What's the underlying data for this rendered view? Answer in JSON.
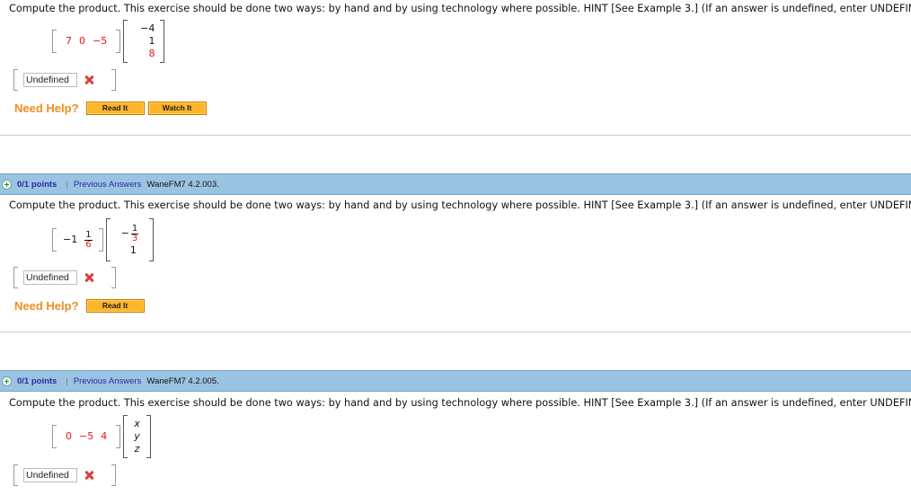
{
  "colors": {
    "accent_orange": "#f28c1e",
    "button_fill": "#fdb52b",
    "header_bar": "#9ac3e2",
    "link_blue": "#2a2aa0",
    "error_red": "#e03a3a",
    "highlight_red": "#e8141a"
  },
  "questions": [
    {
      "prompt": "Compute the product. This exercise should be done two ways: by hand and by using technology where possible. HINT [See Example 3.] (If an answer is undefined, enter UNDEFINED.)",
      "row_vector": [
        "7",
        "0",
        "−5"
      ],
      "col_vector": [
        "−4",
        "1",
        "8"
      ],
      "answer_value": "Undefined",
      "answer_status_icon": "x-icon",
      "help_label": "Need Help?",
      "help_buttons": [
        "Read It",
        "Watch It"
      ]
    },
    {
      "header": {
        "points": "0/1 points",
        "separator": "|",
        "previous_answers": "Previous Answers",
        "question_id": "WaneFM7 4.2.003."
      },
      "prompt": "Compute the product. This exercise should be done two ways: by hand and by using technology where possible. HINT [See Example 3.] (If an answer is undefined, enter UNDEFINED.)",
      "row_vector": {
        "entry1": "−1",
        "entry2_num": "1",
        "entry2_den": "6"
      },
      "col_vector": {
        "entry1_sign": "−",
        "entry1_num": "1",
        "entry1_den": "3",
        "entry2": "1"
      },
      "answer_value": "Undefined",
      "answer_status_icon": "x-icon",
      "help_label": "Need Help?",
      "help_buttons": [
        "Read It"
      ]
    },
    {
      "header": {
        "points": "0/1 points",
        "separator": "|",
        "previous_answers": "Previous Answers",
        "question_id": "WaneFM7 4.2.005."
      },
      "prompt": "Compute the product. This exercise should be done two ways: by hand and by using technology where possible. HINT [See Example 3.] (If an answer is undefined, enter UNDEFINED.)",
      "row_vector": [
        "0",
        "−5",
        "4"
      ],
      "col_vector": [
        "x",
        "y",
        "z"
      ],
      "answer_value": "Undefined",
      "answer_status_icon": "x-icon"
    }
  ]
}
